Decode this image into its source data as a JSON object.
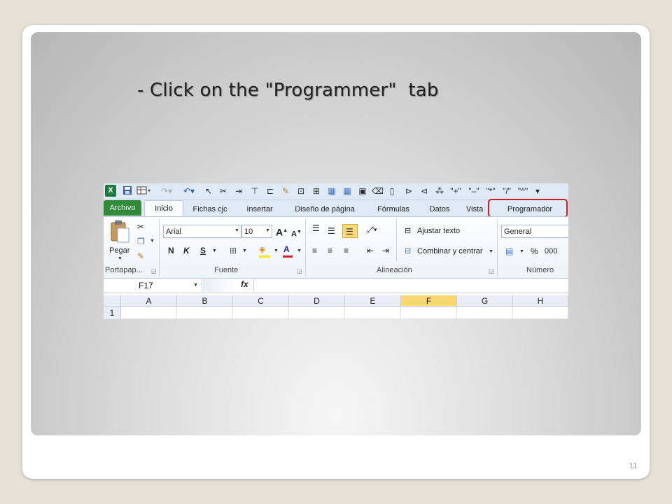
{
  "slide": {
    "title": "- Click on the \"Programmer\"  tab",
    "page_number": "11"
  },
  "excel": {
    "qat_icons": [
      "excel-logo",
      "save-icon",
      "table-icon",
      "redo-icon",
      "undo-icon",
      "cursor-icon",
      "scissors-icon",
      "arrow-icon",
      "tree-icon",
      "connect-icon",
      "brush-icon",
      "frame-icon",
      "frame2-icon",
      "image-icon",
      "grid-icon",
      "box-icon",
      "eraser-icon",
      "doc-icon",
      "shapes-icon",
      "shapes2-icon",
      "shapes3-icon"
    ],
    "tabs": [
      "Archivo",
      "Inicio",
      "Fichas cjc",
      "Insertar",
      "Diseño de página",
      "Fórmulas",
      "Datos",
      "Vista",
      "Programador"
    ],
    "ribbon": {
      "clipboard": {
        "paste_label": "Pegar",
        "group_label": "Portapap..."
      },
      "font": {
        "font_name": "Arial",
        "font_size": "10",
        "bold": "N",
        "italic": "K",
        "underline": "S",
        "group_label": "Fuente"
      },
      "alignment": {
        "wrap_text": "Ajustar texto",
        "merge_center": "Combinar y centrar",
        "group_label": "Alineación"
      },
      "number": {
        "format": "General",
        "percent": "%",
        "thousands": "000",
        "group_label": "Número"
      }
    },
    "formula_bar": {
      "name_box": "F17",
      "fx": "fx"
    },
    "columns": [
      "A",
      "B",
      "C",
      "D",
      "E",
      "F",
      "G",
      "H"
    ],
    "selected_column": "F",
    "rows": [
      "1"
    ]
  }
}
